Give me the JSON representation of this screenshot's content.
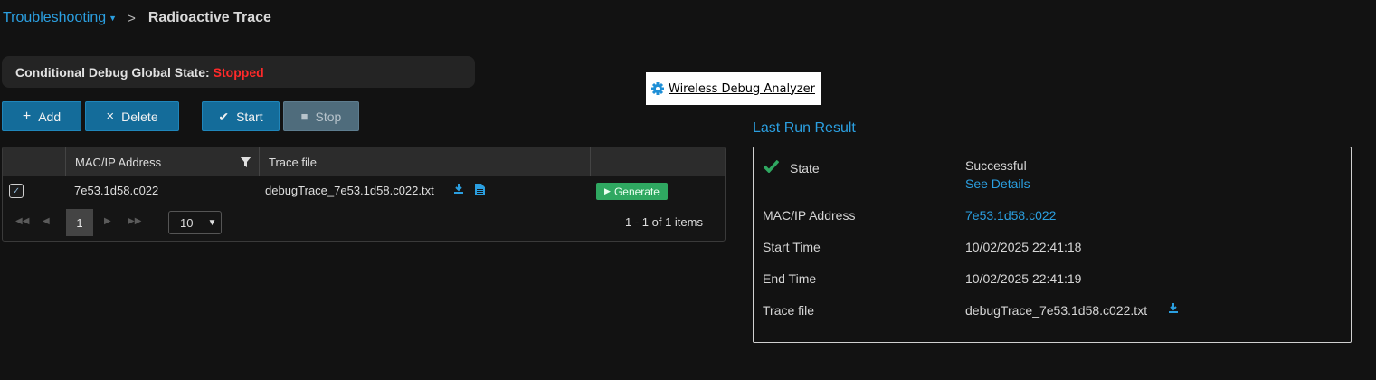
{
  "breadcrumb": {
    "parent": "Troubleshooting",
    "separator": ">",
    "current": "Radioactive Trace"
  },
  "global_state": {
    "label": "Conditional Debug Global State:",
    "value": "Stopped",
    "value_color": "#ff2a2a"
  },
  "toolbar": {
    "add": "Add",
    "delete": "Delete",
    "start": "Start",
    "stop": "Stop"
  },
  "grid": {
    "columns": [
      "MAC/IP Address",
      "Trace file"
    ],
    "rows": [
      {
        "checked": true,
        "mac": "7e53.1d58.c022",
        "trace_file": "debugTrace_7e53.1d58.c022.txt",
        "action": "Generate"
      }
    ],
    "pager": {
      "current_page": "1",
      "page_size": "10",
      "summary": "1 - 1 of 1 items"
    }
  },
  "analyzer": {
    "label": "Wireless Debug Analyzer"
  },
  "last_run": {
    "title": "Last Run Result",
    "state_label": "State",
    "state_value": "Successful",
    "see_details": "See Details",
    "mac_label": "MAC/IP Address",
    "mac_value": "7e53.1d58.c022",
    "start_label": "Start Time",
    "start_value": "10/02/2025 22:41:18",
    "end_label": "End Time",
    "end_value": "10/02/2025 22:41:19",
    "trace_label": "Trace file",
    "trace_value": "debugTrace_7e53.1d58.c022.txt"
  },
  "colors": {
    "accent": "#2b9fe0",
    "button": "#146c9a",
    "success": "#2fa861",
    "danger": "#ff2a2a"
  }
}
